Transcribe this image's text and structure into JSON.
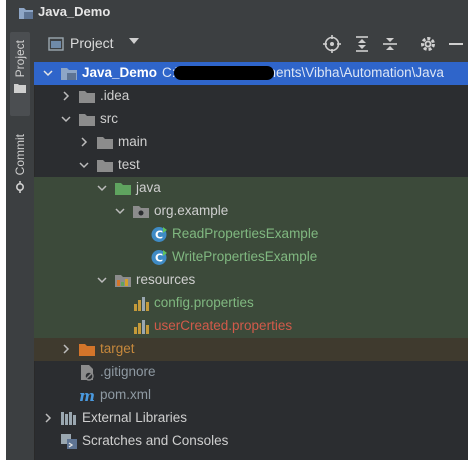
{
  "window": {
    "title": "Java_Demo"
  },
  "sidebar": {
    "tabs": [
      {
        "label": "Project"
      },
      {
        "label": "Commit"
      }
    ]
  },
  "toolbar": {
    "title": "Project",
    "icons": [
      "locate-icon",
      "expand-all-icon",
      "collapse-all-icon",
      "gear-icon",
      "hide-icon"
    ]
  },
  "tree": {
    "root": {
      "name": "Java_Demo",
      "path": "C:\\Users\\...\\Documents\\Vibha\\Automation\\Java"
    },
    "items": {
      "idea": ".idea",
      "src": "src",
      "main": "main",
      "test": "test",
      "java": "java",
      "package": "org.example",
      "class1": "ReadPropertiesExample",
      "class2": "WritePropertiesExample",
      "resources": "resources",
      "file1": "config.properties",
      "file2": "userCreated.properties",
      "target": "target",
      "gitignore": ".gitignore",
      "pom": "pom.xml",
      "libraries": "External Libraries",
      "scratches": "Scratches and Consoles"
    }
  },
  "colors": {
    "selection": "#2f65ca",
    "test_bg": "#3c4a3a",
    "excluded_bg": "#3f3a2e",
    "folder_blue": "#8ea6c6",
    "folder_green": "#5fa35f",
    "folder_orange": "#d4752a"
  }
}
